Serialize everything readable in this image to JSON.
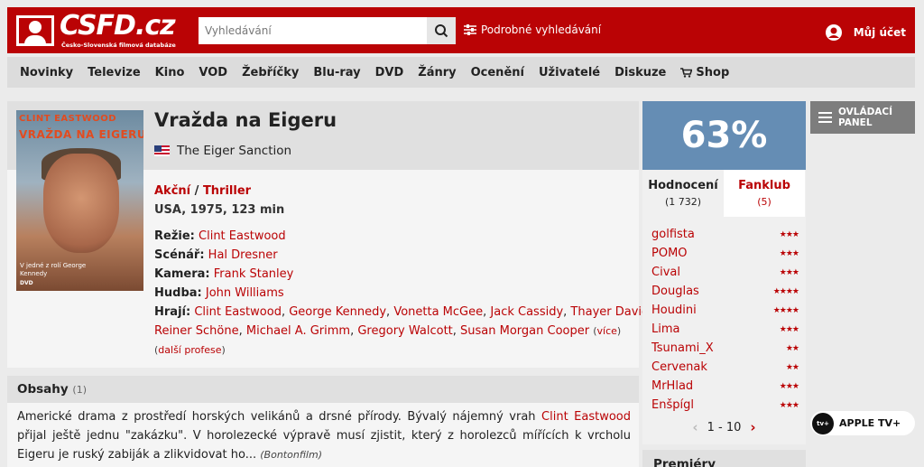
{
  "header": {
    "logo_text": "CSFD.cz",
    "logo_tagline": "Česko-Slovenská filmová databáze",
    "search_placeholder": "Vyhledávání",
    "advanced_search_label": "Podrobné vyhledávání",
    "account_label": "Můj účet"
  },
  "nav": {
    "items": [
      "Novinky",
      "Televize",
      "Kino",
      "VOD",
      "Žebříčky",
      "Blu-ray",
      "DVD",
      "Žánry",
      "Ocenění",
      "Uživatelé",
      "Diskuze"
    ],
    "shop_label": "Shop"
  },
  "film": {
    "title": "Vražda na Eigeru",
    "original_title": "The Eiger Sanction",
    "poster": {
      "top_text": "CLINT EASTWOOD",
      "title_text": "VRAŽDA NA EIGERU",
      "caption": "V jedné z rolí George Kennedy",
      "badge": "DVD"
    },
    "genres": [
      "Akční",
      "Thriller"
    ],
    "genre_separator": " / ",
    "origin": "USA, 1975, 123 min",
    "credits": {
      "director_label": "Režie:",
      "director": "Clint Eastwood",
      "writer_label": "Scénář:",
      "writer": "Hal Dresner",
      "camera_label": "Kamera:",
      "camera": "Frank Stanley",
      "music_label": "Hudba:",
      "music": "John Williams",
      "cast_label": "Hrají:",
      "cast": [
        "Clint Eastwood",
        "George Kennedy",
        "Vonetta McGee",
        "Jack Cassidy",
        "Thayer David",
        "Reiner Schöne",
        "Michael A. Grimm",
        "Gregory Walcott",
        "Susan Morgan Cooper"
      ],
      "more_label": "(více)",
      "more_professions": "(další profese)"
    }
  },
  "plot": {
    "heading": "Obsahy",
    "count": "(1)",
    "text_before": "Americké drama z prostředí horských velikánů a drsné přírody. Bývalý nájemný vrah ",
    "text_link": "Clint Eastwood",
    "text_after": " přijal ještě jednu \"zakázku\". V horolezecké výpravě musí zjistit, který z horolezců mířících k vrcholu Eigeru je ruský zabiják a zlikvidovat ho...",
    "source": "(Bontonfilm)"
  },
  "rating": {
    "score": "63%",
    "tab_ratings_label": "Hodnocení",
    "tab_ratings_count": "(1 732)",
    "tab_fanclub_label": "Fanklub",
    "tab_fanclub_count": "(5)",
    "users": [
      {
        "name": "golfista",
        "stars": 3
      },
      {
        "name": "POMO",
        "stars": 3
      },
      {
        "name": "Cival",
        "stars": 3
      },
      {
        "name": "Douglas",
        "stars": 4
      },
      {
        "name": "Houdini",
        "stars": 4
      },
      {
        "name": "Lima",
        "stars": 3
      },
      {
        "name": "Tsunami_X",
        "stars": 2
      },
      {
        "name": "Cervenak",
        "stars": 2
      },
      {
        "name": "MrHlad",
        "stars": 3
      },
      {
        "name": "Enšpígl",
        "stars": 3
      }
    ],
    "pager_label": "1 - 10"
  },
  "premiery_heading": "Premiéry",
  "sidebar": {
    "control_panel_label": "OVLÁDACÍ PANEL",
    "apple_tv_label": "APPLE TV+",
    "apple_tv_icon_text": "tv+"
  },
  "colors": {
    "brand": "#ba0305",
    "score_bg": "#658db4"
  }
}
